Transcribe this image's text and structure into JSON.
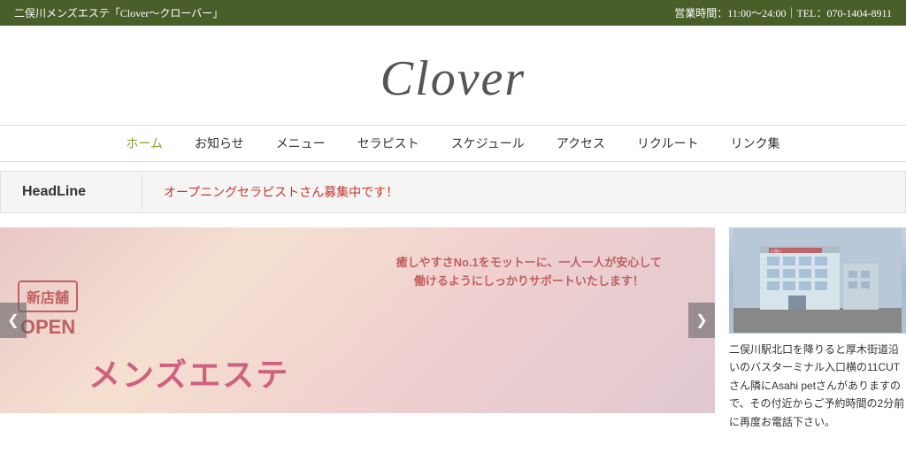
{
  "topbar": {
    "site_title": "二俣川メンズエステ「Clover〜クローバー」",
    "business_info": "営業時間：11:00〜24:00｜TEL：070-1404-8911"
  },
  "logo": {
    "text": "Clover"
  },
  "nav": {
    "items": [
      {
        "label": "ホーム",
        "active": true
      },
      {
        "label": "お知らせ",
        "active": false
      },
      {
        "label": "メニュー",
        "active": false
      },
      {
        "label": "セラピスト",
        "active": false
      },
      {
        "label": "スケジュール",
        "active": false
      },
      {
        "label": "アクセス",
        "active": false
      },
      {
        "label": "リクルート",
        "active": false
      },
      {
        "label": "リンク集",
        "active": false
      }
    ]
  },
  "headline": {
    "label": "HeadLine",
    "content": "オープニングセラピストさん募集中です！"
  },
  "slideshow": {
    "overlay_text": "癒しやすさNo.1をモットーに、一人一人が安心して\n働けるようにしっかりサポートいたします！",
    "main_text": "メンズエステ",
    "new_label": "新店舗",
    "open_label": "OPEN",
    "prev_arrow": "❮",
    "next_arrow": "❯"
  },
  "side_panel": {
    "description": "二俣川駅北口を降りると厚木街道沿いのバスターミナル入口横の11CUTさん隣にAsahi petさんがありますので、その付近からご予約時間の2分前に再度お電話下さい。"
  }
}
